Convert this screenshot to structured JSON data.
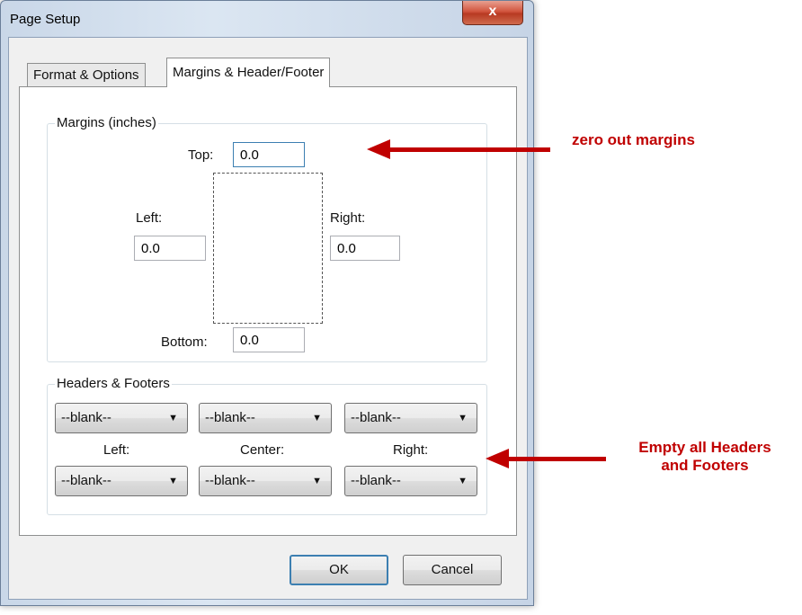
{
  "window": {
    "title": "Page Setup",
    "close_glyph": "x"
  },
  "tabs": [
    {
      "label": "Format & Options",
      "active": false
    },
    {
      "label": "Margins & Header/Footer",
      "active": true
    }
  ],
  "margins": {
    "group_label": "Margins (inches)",
    "top": {
      "label": "Top:",
      "value": "0.0"
    },
    "left": {
      "label": "Left:",
      "value": "0.0"
    },
    "right": {
      "label": "Right:",
      "value": "0.0"
    },
    "bottom": {
      "label": "Bottom:",
      "value": "0.0"
    }
  },
  "headers_footers": {
    "group_label": "Headers & Footers",
    "header_selects": [
      "--blank--",
      "--blank--",
      "--blank--"
    ],
    "column_labels": [
      "Left:",
      "Center:",
      "Right:"
    ],
    "footer_selects": [
      "--blank--",
      "--blank--",
      "--blank--"
    ]
  },
  "buttons": {
    "ok": "OK",
    "cancel": "Cancel"
  },
  "annotations": {
    "margins_note": "zero out margins",
    "headers_note_line1": "Empty all Headers",
    "headers_note_line2": "and Footers",
    "color": "#c00000"
  },
  "icons": {
    "dropdown_arrow": "chevron-down-icon",
    "close": "close-icon"
  }
}
